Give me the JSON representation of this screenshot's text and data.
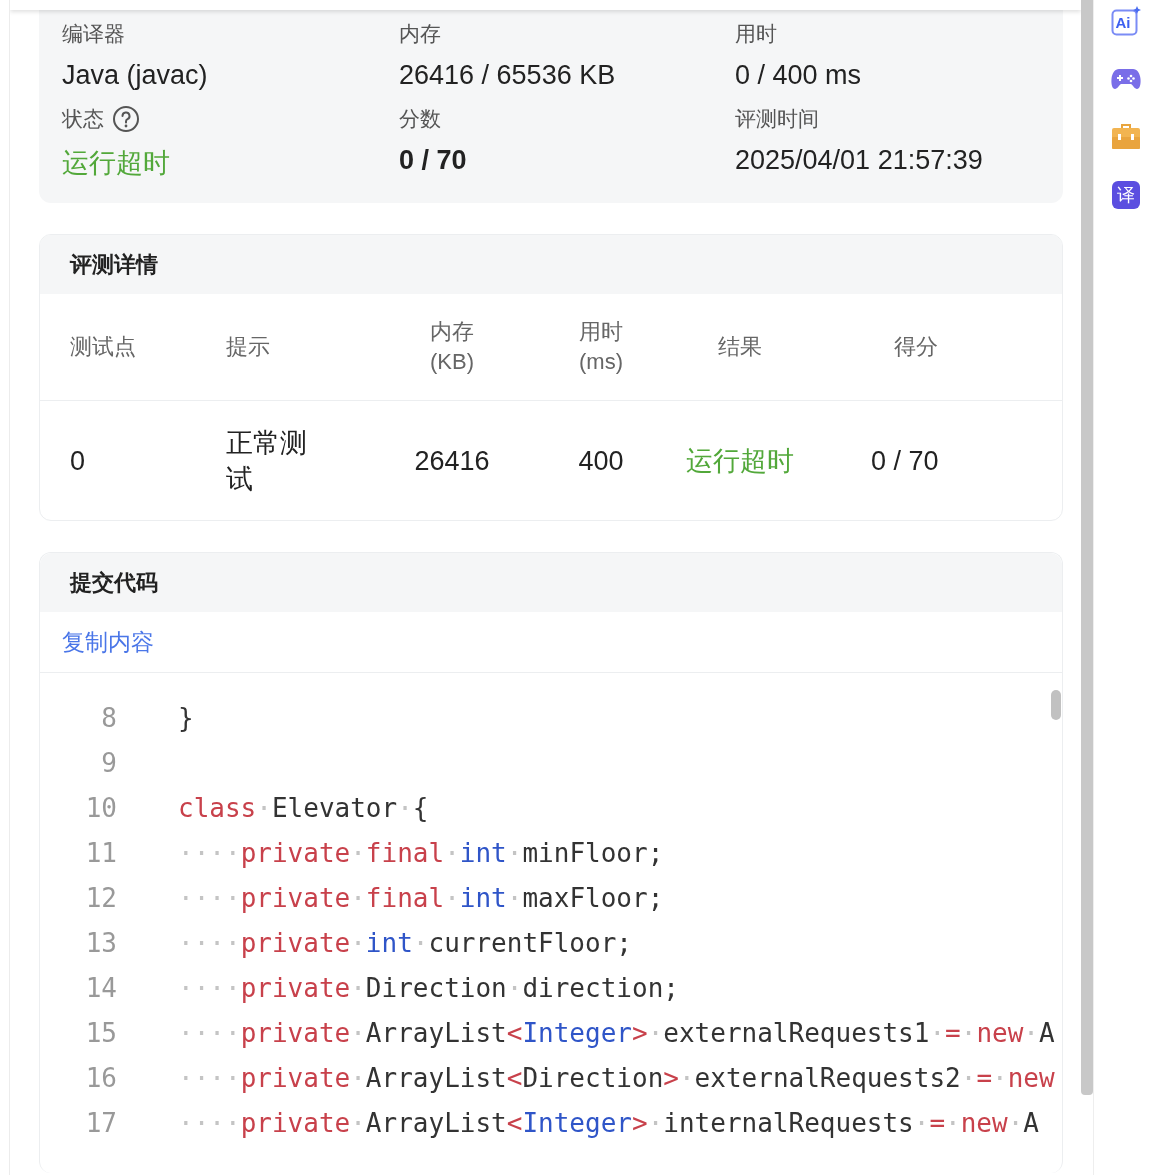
{
  "summary": [
    {
      "label": "编译器",
      "value": "Java (javac)",
      "kind": "plain"
    },
    {
      "label": "内存",
      "value": "26416 / 65536 KB",
      "kind": "plain"
    },
    {
      "label": "用时",
      "value": "0 / 400 ms",
      "kind": "plain"
    },
    {
      "label": "状态",
      "value": "运行超时",
      "kind": "status",
      "help": true
    },
    {
      "label": "分数",
      "value": "0 / 70",
      "kind": "score"
    },
    {
      "label": "评测时间",
      "value": "2025/04/01 21:57:39",
      "kind": "plain"
    }
  ],
  "details": {
    "title": "评测详情",
    "columns": [
      "测试点",
      "提示",
      "内存 (KB)",
      "用时 (ms)",
      "结果",
      "得分"
    ],
    "rows": [
      {
        "cells": [
          "0",
          "正常测试",
          "26416",
          "400",
          "运行超时",
          "0 / 70"
        ],
        "color": "#52a83a"
      }
    ]
  },
  "code": {
    "title": "提交代码",
    "copy": "复制内容",
    "lines": [
      {
        "n": "8",
        "tokens": [
          {
            "kind": "plain",
            "t": "}"
          }
        ]
      },
      {
        "n": "9"
      },
      {
        "n": "10",
        "tokens": [
          {
            "kind": "kw",
            "t": "class"
          },
          {
            "kind": "ws",
            "t": "·"
          },
          {
            "kind": "plain",
            "t": "Elevator"
          },
          {
            "kind": "ws",
            "t": "·"
          },
          {
            "kind": "plain",
            "t": "{"
          }
        ]
      },
      {
        "n": "11",
        "tokens": [
          {
            "kind": "ws",
            "t": "····"
          },
          {
            "kind": "kw",
            "t": "private"
          },
          {
            "kind": "ws",
            "t": "·"
          },
          {
            "kind": "kw",
            "t": "final"
          },
          {
            "kind": "ws",
            "t": "·"
          },
          {
            "kind": "type",
            "t": "int"
          },
          {
            "kind": "ws",
            "t": "·"
          },
          {
            "kind": "plain",
            "t": "minFloor;"
          }
        ]
      },
      {
        "n": "12",
        "tokens": [
          {
            "kind": "ws",
            "t": "····"
          },
          {
            "kind": "kw",
            "t": "private"
          },
          {
            "kind": "ws",
            "t": "·"
          },
          {
            "kind": "kw",
            "t": "final"
          },
          {
            "kind": "ws",
            "t": "·"
          },
          {
            "kind": "type",
            "t": "int"
          },
          {
            "kind": "ws",
            "t": "·"
          },
          {
            "kind": "plain",
            "t": "maxFloor;"
          }
        ]
      },
      {
        "n": "13",
        "tokens": [
          {
            "kind": "ws",
            "t": "····"
          },
          {
            "kind": "kw",
            "t": "private"
          },
          {
            "kind": "ws",
            "t": "·"
          },
          {
            "kind": "type",
            "t": "int"
          },
          {
            "kind": "ws",
            "t": "·"
          },
          {
            "kind": "plain",
            "t": "currentFloor;"
          }
        ]
      },
      {
        "n": "14",
        "tokens": [
          {
            "kind": "ws",
            "t": "····"
          },
          {
            "kind": "kw",
            "t": "private"
          },
          {
            "kind": "ws",
            "t": "·"
          },
          {
            "kind": "plain",
            "t": "Direction"
          },
          {
            "kind": "ws",
            "t": "·"
          },
          {
            "kind": "plain",
            "t": "direction;"
          }
        ]
      },
      {
        "n": "15",
        "tokens": [
          {
            "kind": "ws",
            "t": "····"
          },
          {
            "kind": "kw",
            "t": "private"
          },
          {
            "kind": "ws",
            "t": "·"
          },
          {
            "kind": "plain",
            "t": "ArrayList"
          },
          {
            "kind": "op",
            "t": "<"
          },
          {
            "kind": "type",
            "t": "Integer"
          },
          {
            "kind": "op",
            "t": ">"
          },
          {
            "kind": "ws",
            "t": "·"
          },
          {
            "kind": "plain",
            "t": "externalRequests1"
          },
          {
            "kind": "ws",
            "t": "·"
          },
          {
            "kind": "op",
            "t": "="
          },
          {
            "kind": "ws",
            "t": "·"
          },
          {
            "kind": "kw",
            "t": "new"
          },
          {
            "kind": "ws",
            "t": "·"
          },
          {
            "kind": "plain",
            "t": "A"
          }
        ]
      },
      {
        "n": "16",
        "tokens": [
          {
            "kind": "ws",
            "t": "····"
          },
          {
            "kind": "kw",
            "t": "private"
          },
          {
            "kind": "ws",
            "t": "·"
          },
          {
            "kind": "plain",
            "t": "ArrayList"
          },
          {
            "kind": "op",
            "t": "<"
          },
          {
            "kind": "plain",
            "t": "Direction"
          },
          {
            "kind": "op",
            "t": ">"
          },
          {
            "kind": "ws",
            "t": "·"
          },
          {
            "kind": "plain",
            "t": "externalRequests2"
          },
          {
            "kind": "ws",
            "t": "·"
          },
          {
            "kind": "op",
            "t": "="
          },
          {
            "kind": "ws",
            "t": "·"
          },
          {
            "kind": "kw",
            "t": "new"
          }
        ]
      },
      {
        "n": "17",
        "tokens": [
          {
            "kind": "ws",
            "t": "····"
          },
          {
            "kind": "kw",
            "t": "private"
          },
          {
            "kind": "ws",
            "t": "·"
          },
          {
            "kind": "plain",
            "t": "ArrayList"
          },
          {
            "kind": "op",
            "t": "<"
          },
          {
            "kind": "type",
            "t": "Integer"
          },
          {
            "kind": "op",
            "t": ">"
          },
          {
            "kind": "ws",
            "t": "·"
          },
          {
            "kind": "plain",
            "t": "internalRequests"
          },
          {
            "kind": "ws",
            "t": "·"
          },
          {
            "kind": "op",
            "t": "="
          },
          {
            "kind": "ws",
            "t": "·"
          },
          {
            "kind": "kw",
            "t": "new"
          },
          {
            "kind": "ws",
            "t": "·"
          },
          {
            "kind": "plain",
            "t": "A"
          }
        ]
      }
    ]
  },
  "tools": [
    {
      "kind": "ai",
      "glyph": "Ai"
    },
    {
      "kind": "game"
    },
    {
      "kind": "briefcase"
    },
    {
      "kind": "translate",
      "glyph": "译"
    }
  ]
}
